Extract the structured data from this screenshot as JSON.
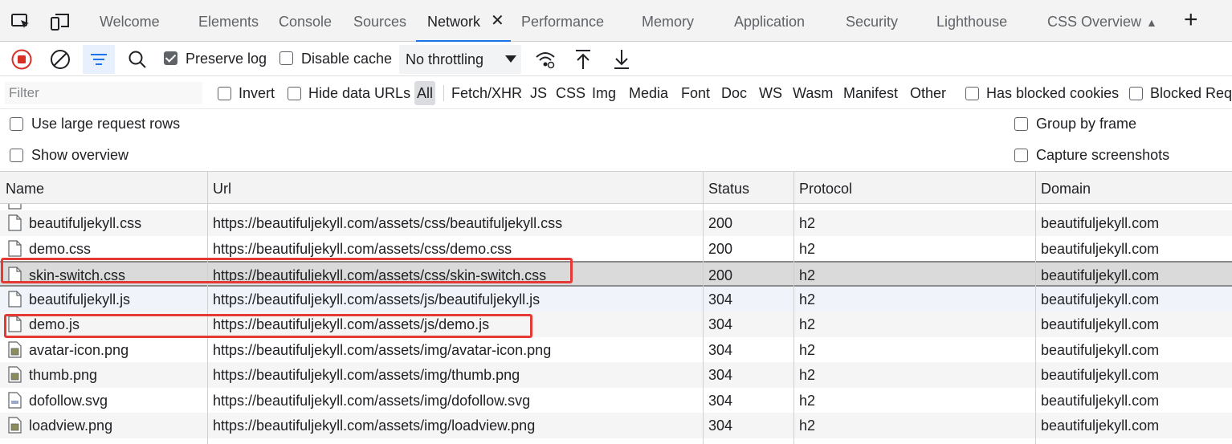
{
  "tabs": [
    {
      "label": "Welcome",
      "active": false
    },
    {
      "label": "Elements",
      "active": false
    },
    {
      "label": "Console",
      "active": false
    },
    {
      "label": "Sources",
      "active": false
    },
    {
      "label": "Network",
      "active": true
    },
    {
      "label": "Performance",
      "active": false
    },
    {
      "label": "Memory",
      "active": false
    },
    {
      "label": "Application",
      "active": false
    },
    {
      "label": "Security",
      "active": false
    },
    {
      "label": "Lighthouse",
      "active": false
    },
    {
      "label": "CSS Overview",
      "active": false
    }
  ],
  "tab_close_glyph": "✕",
  "add_tab_glyph": "+",
  "toolbar": {
    "preserve_log": {
      "label": "Preserve log",
      "checked": true
    },
    "disable_cache": {
      "label": "Disable cache",
      "checked": false
    },
    "throttling": "No throttling"
  },
  "filter": {
    "placeholder": "Filter",
    "invert": "Invert",
    "hide_data_urls": "Hide data URLs",
    "types": [
      "All",
      "Fetch/XHR",
      "JS",
      "CSS",
      "Img",
      "Media",
      "Font",
      "Doc",
      "WS",
      "Wasm",
      "Manifest",
      "Other"
    ],
    "active_type": "All",
    "has_blocked_cookies": "Has blocked cookies",
    "blocked_requests": "Blocked Requests"
  },
  "options": {
    "large_rows": "Use large request rows",
    "show_overview": "Show overview",
    "group_by_frame": "Group by frame",
    "capture_screenshots": "Capture screenshots"
  },
  "columns": [
    "Name",
    "Url",
    "Status",
    "Protocol",
    "Domain"
  ],
  "rows": [
    {
      "name": "beautifuljekyll.css",
      "url": "https://beautifuljekyll.com/assets/css/beautifuljekyll.css",
      "status": "200",
      "protocol": "h2",
      "domain": "beautifuljekyll.com",
      "icon": "file-icon"
    },
    {
      "name": "demo.css",
      "url": "https://beautifuljekyll.com/assets/css/demo.css",
      "status": "200",
      "protocol": "h2",
      "domain": "beautifuljekyll.com",
      "icon": "file-icon"
    },
    {
      "name": "skin-switch.css",
      "url": "https://beautifuljekyll.com/assets/css/skin-switch.css",
      "status": "200",
      "protocol": "h2",
      "domain": "beautifuljekyll.com",
      "icon": "file-icon",
      "selected": true
    },
    {
      "name": "beautifuljekyll.js",
      "url": "https://beautifuljekyll.com/assets/js/beautifuljekyll.js",
      "status": "304",
      "protocol": "h2",
      "domain": "beautifuljekyll.com",
      "icon": "file-icon"
    },
    {
      "name": "demo.js",
      "url": "https://beautifuljekyll.com/assets/js/demo.js",
      "status": "304",
      "protocol": "h2",
      "domain": "beautifuljekyll.com",
      "icon": "file-icon"
    },
    {
      "name": "avatar-icon.png",
      "url": "https://beautifuljekyll.com/assets/img/avatar-icon.png",
      "status": "304",
      "protocol": "h2",
      "domain": "beautifuljekyll.com",
      "icon": "image-file-icon"
    },
    {
      "name": "thumb.png",
      "url": "https://beautifuljekyll.com/assets/img/thumb.png",
      "status": "304",
      "protocol": "h2",
      "domain": "beautifuljekyll.com",
      "icon": "image-file-icon"
    },
    {
      "name": "dofollow.svg",
      "url": "https://beautifuljekyll.com/assets/img/dofollow.svg",
      "status": "304",
      "protocol": "h2",
      "domain": "beautifuljekyll.com",
      "icon": "svg-file-icon"
    },
    {
      "name": "loadview.png",
      "url": "https://beautifuljekyll.com/assets/img/loadview.png",
      "status": "304",
      "protocol": "h2",
      "domain": "beautifuljekyll.com",
      "icon": "image-file-icon"
    }
  ],
  "colors": {
    "accent": "#1a73e8",
    "record": "#d93025",
    "highlight": "#e53935"
  }
}
